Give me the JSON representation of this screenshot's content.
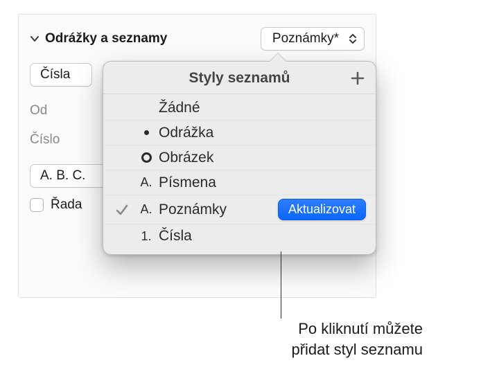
{
  "section": {
    "title": "Odrážky a seznamy",
    "style_selected": "Poznámky*"
  },
  "type_row": {
    "selected": "Čísla"
  },
  "labels": {
    "indent_partial": "Od",
    "number_partial": "Číslo",
    "order_partial": "Řada"
  },
  "format": {
    "value": "A. B. C."
  },
  "popover": {
    "title": "Styly seznamů",
    "items": [
      {
        "marker_type": "none",
        "marker": "",
        "name": "Žádné",
        "checked": false,
        "update": false
      },
      {
        "marker_type": "bullet",
        "marker": "",
        "name": "Odrážka",
        "checked": false,
        "update": false
      },
      {
        "marker_type": "circle",
        "marker": "",
        "name": "Obrázek",
        "checked": false,
        "update": false
      },
      {
        "marker_type": "text",
        "marker": "A.",
        "name": "Písmena",
        "checked": false,
        "update": false
      },
      {
        "marker_type": "text",
        "marker": "A.",
        "name": "Poznámky",
        "checked": true,
        "update": true
      },
      {
        "marker_type": "text",
        "marker": "1.",
        "name": "Čísla",
        "checked": false,
        "update": false
      }
    ],
    "update_label": "Aktualizovat"
  },
  "callout": {
    "line1": "Po kliknutí můžete",
    "line2": "přidat styl seznamu"
  }
}
